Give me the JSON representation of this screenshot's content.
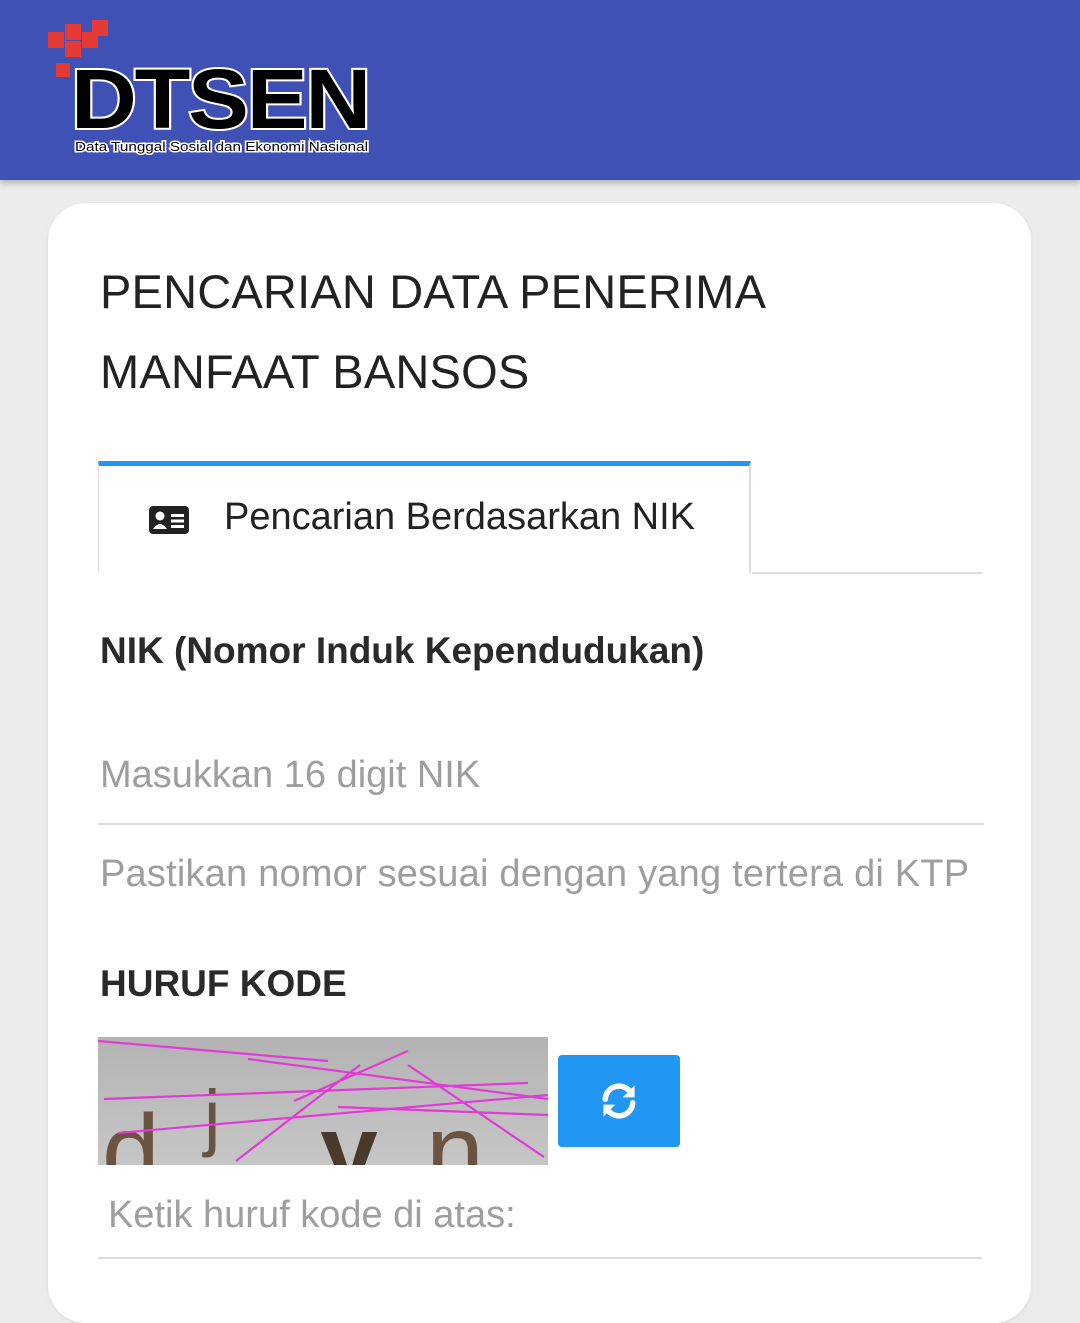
{
  "header": {
    "logo_text": "DTSEN",
    "logo_subtitle": "Data Tunggal Sosial dan Ekonomi Nasional"
  },
  "page": {
    "title_line1": "PENCARIAN DATA PENERIMA",
    "title_line2": "MANFAAT BANSOS"
  },
  "tabs": [
    {
      "label": "Pencarian Berdasarkan NIK",
      "icon": "id-card-icon",
      "active": true
    }
  ],
  "form": {
    "nik_label": "NIK (Nomor Induk Kependudukan)",
    "nik_placeholder": "Masukkan 16 digit NIK",
    "nik_value": "",
    "nik_helper": "Pastikan nomor sesuai dengan yang tertera di KTP",
    "kode_label": "HURUF KODE",
    "captcha_text": "djyn",
    "refresh_icon": "refresh-icon",
    "kode_placeholder": "Ketik huruf kode di atas:",
    "kode_value": ""
  },
  "colors": {
    "header_bg": "#3f51b5",
    "accent": "#2196f3",
    "logo_red": "#e53935"
  }
}
